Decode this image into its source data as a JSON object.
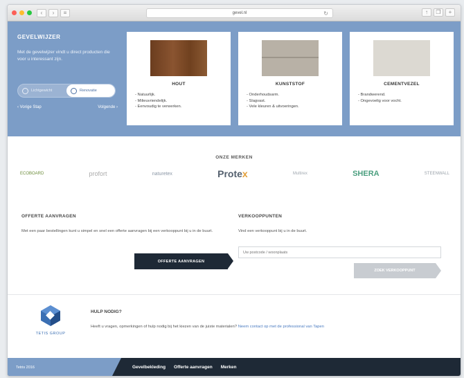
{
  "browser": {
    "url": "gevel.nl",
    "nav_back": "‹",
    "nav_forward": "›",
    "nav_extra": "≡"
  },
  "hero": {
    "title": "GEVELWIJZER",
    "subtitle": "Met de gevelwijzer vindt u direct producten die voor u interessant zijn.",
    "toggle_left": "Lichtgewicht",
    "toggle_right": "Renovatie",
    "link_prev": "‹ Vorige Stap",
    "link_next": "Volgende ›"
  },
  "cards": [
    {
      "title": "HOUT",
      "items": [
        "Natuurlijk.",
        "Milieuvriendelijk.",
        "Eenvoudig te verwerken."
      ]
    },
    {
      "title": "KUNSTSTOF",
      "items": [
        "Onderhoudsarm.",
        "Slagvast.",
        "Vele kleuren & uitvoeringen."
      ]
    },
    {
      "title": "CEMENTVEZEL",
      "items": [
        "Brandwerend.",
        "Ongevoelig voor vocht."
      ]
    }
  ],
  "brands": {
    "title": "ONZE MERKEN",
    "items": [
      "ECOBOARD",
      "profort",
      "naturetex",
      "Prote",
      "Multirex",
      "SHERA",
      "STEENWALL"
    ],
    "protex_suffix": "x"
  },
  "offerte": {
    "title": "OFFERTE AANVRAGEN",
    "text": "Met een paar bestellingen kunt u simpel en snel een offerte aanvragen bij een verkooppunt bij u in de buurt.",
    "button": "OFFERTE AANVRAGEN"
  },
  "verkooppunten": {
    "title": "VERKOOPPUNTEN",
    "text": "Vind een verkooppunt bij u in de buurt.",
    "placeholder": "Uw postcode / woonplaats",
    "button": "ZOEK VERKOOPPUNT"
  },
  "help": {
    "logo_text": "TETIS GROUP",
    "title": "HULP NODIG?",
    "text": "Heeft u vragen, opmerkingen of hulp nodig bij het kiezen van de juiste materialen?",
    "link": "Neem contact op met de professional van Tapen"
  },
  "footer": {
    "copyright": "Tetris 2016",
    "nav": [
      "Gevelbekleding",
      "Offerte aanvragen",
      "Merken"
    ]
  },
  "colors": {
    "hero_bg": "#7c9dc7",
    "dark": "#1e2936",
    "accent_link": "#4a7bc0"
  }
}
